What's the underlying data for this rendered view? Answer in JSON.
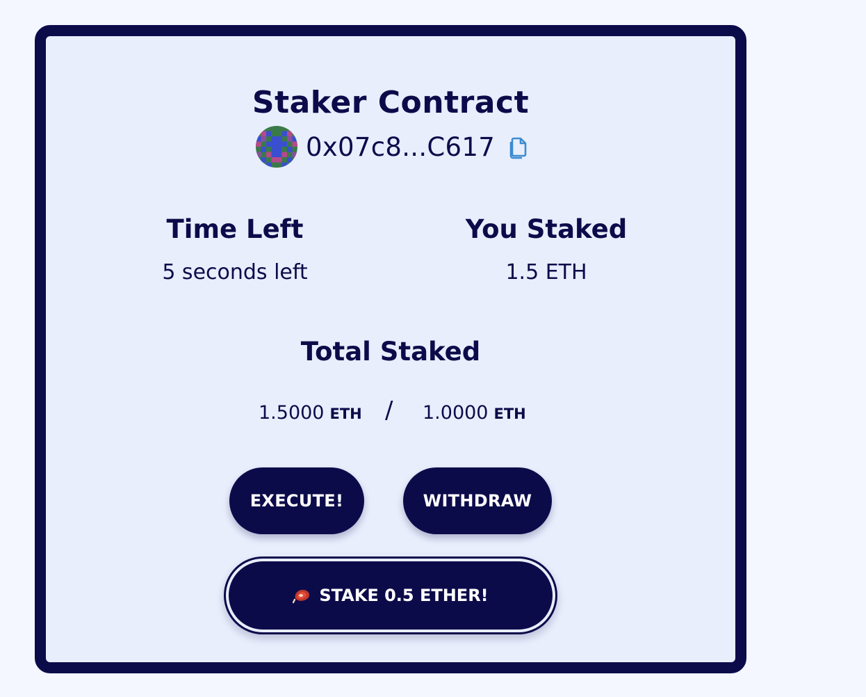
{
  "title": "Staker Contract",
  "address": {
    "display": "0x07c8...C617",
    "copy_icon": "copy-icon",
    "avatar_icon": "blockie-avatar"
  },
  "stats": {
    "time_left": {
      "label": "Time Left",
      "value": "5 seconds left"
    },
    "you_staked": {
      "label": "You Staked",
      "value": "1.5 ETH"
    }
  },
  "total": {
    "label": "Total Staked",
    "current": "1.5000",
    "current_unit": "ETH",
    "separator": "/",
    "threshold": "1.0000",
    "threshold_unit": "ETH"
  },
  "buttons": {
    "execute": "EXECUTE!",
    "withdraw": "WITHDRAW",
    "stake": "STAKE 0.5 ETHER!",
    "stake_icon": "steak-icon"
  },
  "colors": {
    "primary": "#0c0b4a",
    "card_background": "#e8eefc",
    "page_background": "#f4f7ff",
    "copy_icon": "#3d8bd1"
  }
}
